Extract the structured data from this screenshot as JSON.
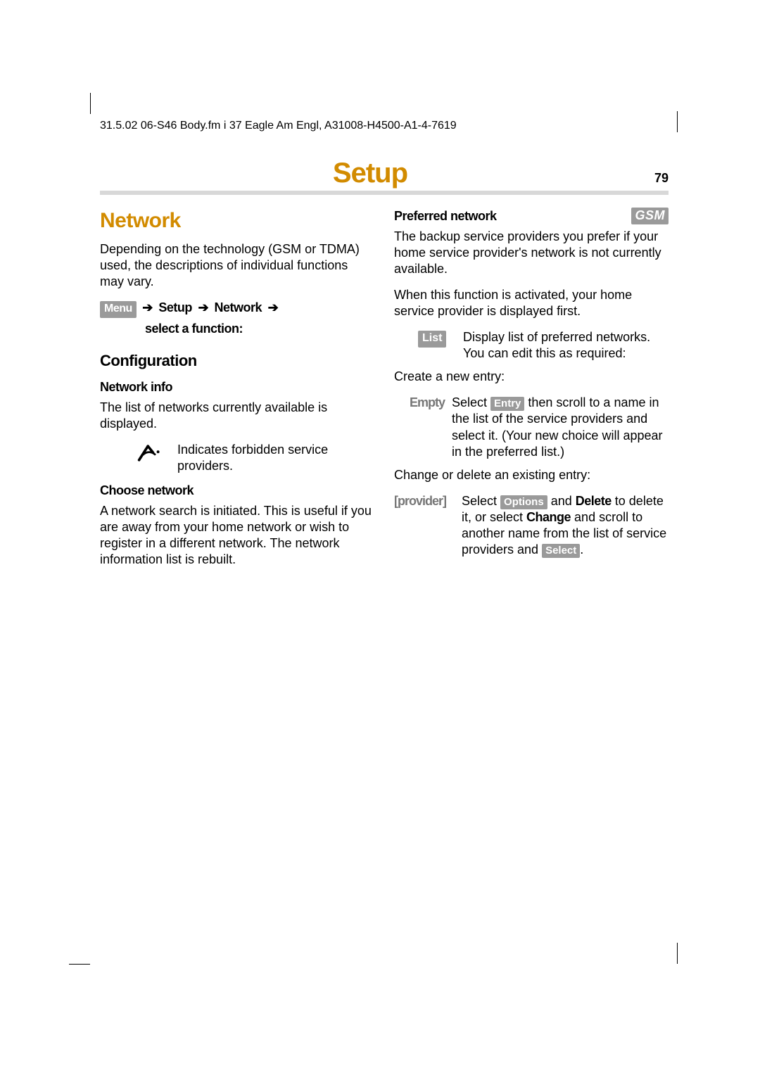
{
  "meta": {
    "line": "31.5.02    06-S46 Body.fm    i 37 Eagle  Am Engl, A31008-H4500-A1-4-7619"
  },
  "page": {
    "title": "Setup",
    "number": "79"
  },
  "left": {
    "section": "Network",
    "intro": "Depending on the technology (GSM or TDMA) used, the descriptions of individual functions may vary.",
    "menu": {
      "label": "Menu",
      "path1": "Setup",
      "path2": "Network",
      "tail": "select a function:",
      "arrow": "➔"
    },
    "config": "Configuration",
    "netinfo_h": "Network info",
    "netinfo_p": "The list of networks currently available is displayed.",
    "forbidden": "Indicates forbidden service providers.",
    "choose_h": "Choose network",
    "choose_p": "A network search is initiated. This is useful if you are away from your home network or wish to register in a different network. The network information list is rebuilt."
  },
  "right": {
    "pref_h": "Preferred network",
    "gsm": "GSM",
    "pref_p1": "The backup service providers you prefer if your home service provider's network is not currently available.",
    "pref_p2": "When this function is activated, your home service provider is displayed first.",
    "list_badge": "List",
    "list_body": "Display list of preferred networks. You can edit this as required:",
    "create": "Create a new entry:",
    "empty_term": "Empty",
    "empty_pre": "Select ",
    "entry_badge": "Entry",
    "empty_post": " then scroll to a name in the list of the service providers and select it. (Your new choice will appear in the preferred list.)",
    "change": "Change or delete an existing entry:",
    "provider_term": "[provider]",
    "prov_pre": "Select ",
    "options_badge": "Options",
    "prov_mid1": " and ",
    "delete_word": "Delete",
    "prov_mid2": " to delete it, or select ",
    "change_word": "Change",
    "prov_mid3": " and scroll to another name from the list of service providers and ",
    "select_badge": "Select",
    "prov_end": "."
  }
}
